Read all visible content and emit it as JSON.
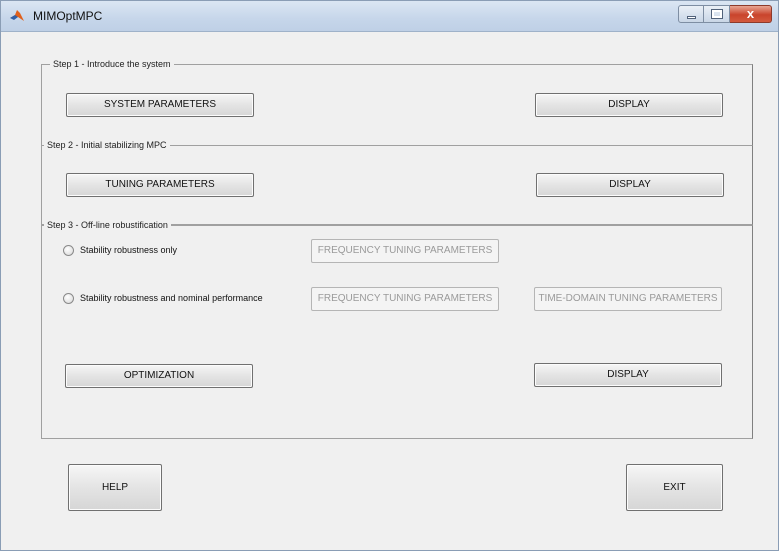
{
  "window": {
    "title": "MIMOptMPC",
    "close_glyph": "x"
  },
  "step1": {
    "title": "Step 1 - Introduce the system",
    "system_parameters": "SYSTEM PARAMETERS",
    "display": "DISPLAY"
  },
  "step2": {
    "title": "Step 2 - Initial stabilizing MPC",
    "tuning_parameters": "TUNING PARAMETERS",
    "display": "DISPLAY"
  },
  "step3": {
    "title": "Step 3 - Off-line robustification",
    "option1_label": "Stability robustness only",
    "option1_freq": "FREQUENCY TUNING PARAMETERS",
    "option2_label": "Stability robustness and nominal performance",
    "option2_freq": "FREQUENCY TUNING PARAMETERS",
    "option2_time": "TIME-DOMAIN TUNING PARAMETERS",
    "optimization": "OPTIMIZATION",
    "display": "DISPLAY"
  },
  "footer": {
    "help": "HELP",
    "exit": "EXIT"
  },
  "icons": {
    "app": "matlab-icon"
  }
}
